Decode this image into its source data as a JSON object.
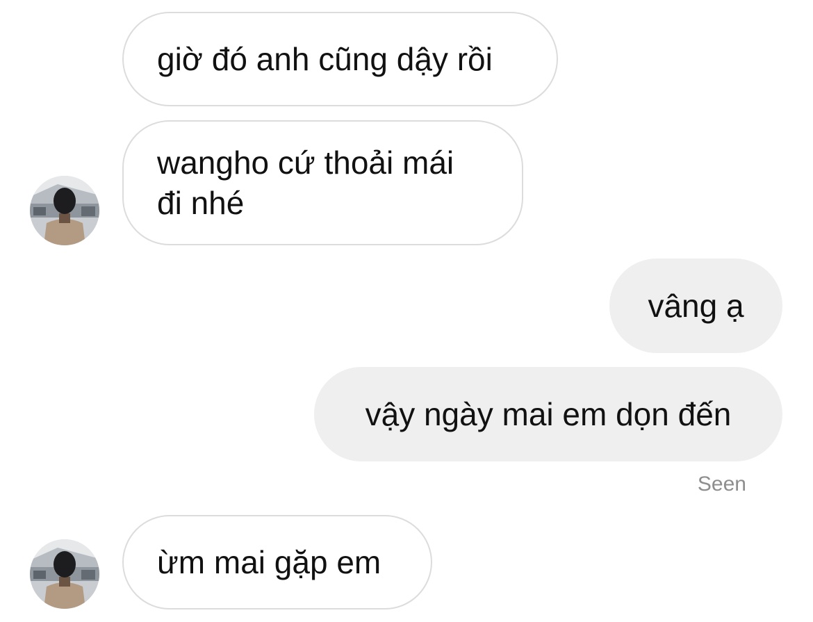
{
  "conversation": {
    "messages": [
      {
        "sender": "other",
        "text": "giờ đó anh cũng dậy rồi"
      },
      {
        "sender": "other",
        "text": "wangho cứ thoải mái\nđi nhé"
      },
      {
        "sender": "me",
        "text": "vâng ạ"
      },
      {
        "sender": "me",
        "text": "vậy ngày mai em dọn đến"
      },
      {
        "sender": "other",
        "text": "ừm mai gặp em"
      }
    ],
    "seen_label": "Seen"
  },
  "colors": {
    "incoming_bubble_border": "#dcdcdc",
    "outgoing_bubble_bg": "#efefef",
    "text": "#111111",
    "seen_text": "#8e8e8e"
  },
  "icons": {
    "avatar": "contact-avatar-photo"
  }
}
